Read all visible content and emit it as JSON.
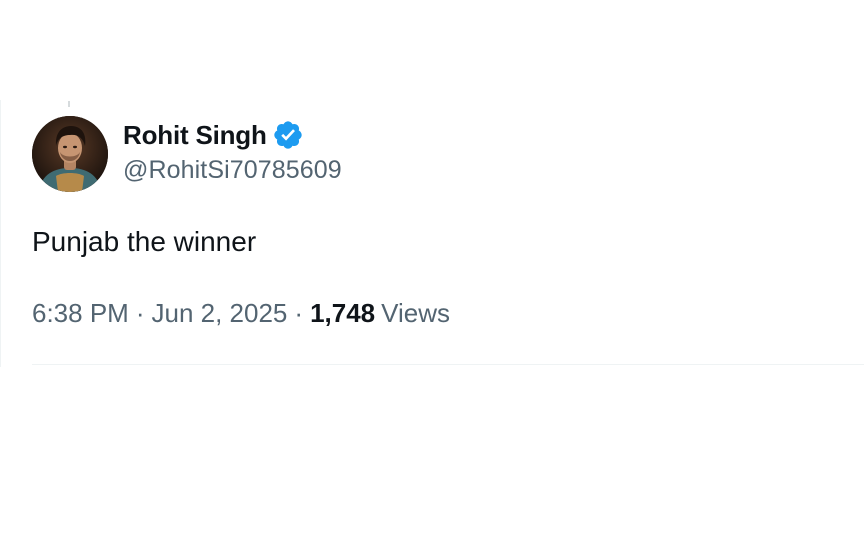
{
  "tweet": {
    "author": {
      "display_name": "Rohit Singh",
      "handle": "@RohitSi70785609",
      "verified": true,
      "verified_badge_color": "#1d9bf0",
      "avatar_icon": "profile-photo"
    },
    "text": "Punjab the winner",
    "meta": {
      "time": "6:38 PM",
      "separator": "·",
      "date": "Jun 2, 2025",
      "views_count": "1,748",
      "views_label": "Views"
    }
  },
  "colors": {
    "primary_text": "#0f1419",
    "secondary_text": "#536471",
    "divider": "#eff3f4",
    "accent": "#1d9bf0"
  }
}
